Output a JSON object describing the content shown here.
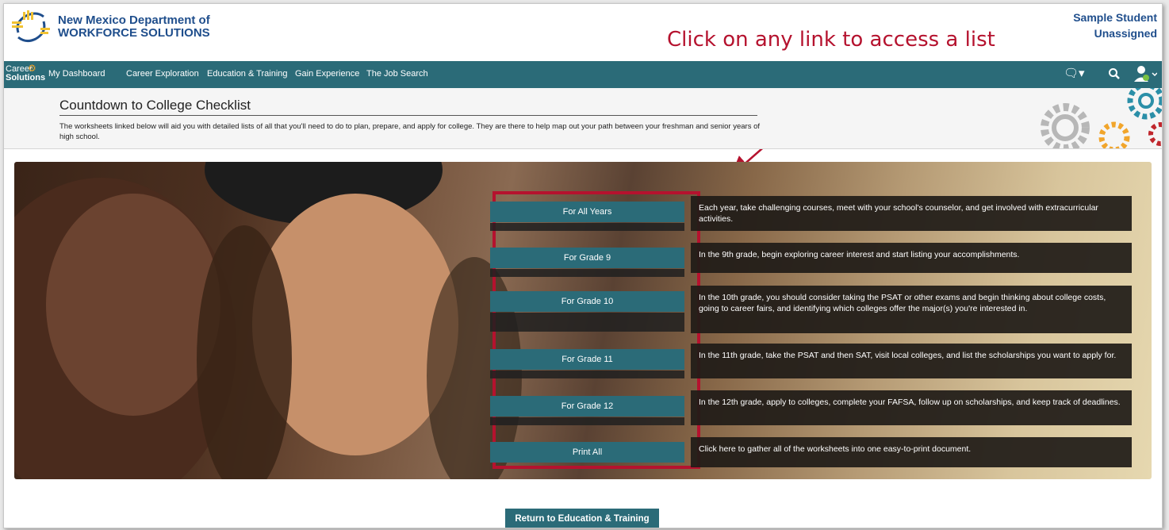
{
  "header": {
    "org_line1": "New Mexico Department of",
    "org_line2": "WORKFORCE SOLUTIONS",
    "callout": "Click on any link to access a list",
    "user_name": "Sample Student",
    "user_status": "Unassigned"
  },
  "nav": {
    "brand_line1": "Career",
    "brand_line2": "Solutions",
    "items": [
      "My Dashboard",
      "Career Exploration",
      "Education & Training",
      "Gain Experience",
      "The Job Search"
    ],
    "icons": [
      "chat-icon",
      "search-icon",
      "user-icon"
    ]
  },
  "page": {
    "title": "Countdown to College Checklist",
    "description": "The worksheets linked below will aid you with detailed lists of all that you'll need to do to plan, prepare, and apply for college. They are there to help map out your path between your freshman and senior years of high school."
  },
  "checklist": [
    {
      "label": "For All Years",
      "description": "Each year, take challenging courses, meet with your school's counselor, and get involved with extracurricular activities."
    },
    {
      "label": "For Grade 9",
      "description": "In the 9th grade, begin exploring career interest and start listing your accomplishments."
    },
    {
      "label": "For Grade 10",
      "description": "In the 10th grade, you should consider taking the PSAT or other exams and begin thinking about college costs, going to career fairs, and identifying which colleges offer the major(s) you're interested in."
    },
    {
      "label": "For Grade 11",
      "description": "In the 11th grade, take the PSAT and then SAT, visit local colleges, and list the scholarships you want to apply for."
    },
    {
      "label": "For Grade 12",
      "description": "In the 12th grade, apply to colleges, complete your FAFSA, follow up on scholarships, and keep track of deadlines."
    },
    {
      "label": "Print All",
      "description": "Click here to gather all of the worksheets into one easy-to-print document."
    }
  ],
  "footer": {
    "return_label": "Return to Education & Training"
  },
  "colors": {
    "nav_teal": "#2b6b78",
    "brand_blue": "#1f4e8c",
    "callout_red": "#b5122e",
    "logo_yellow": "#f1c232"
  }
}
